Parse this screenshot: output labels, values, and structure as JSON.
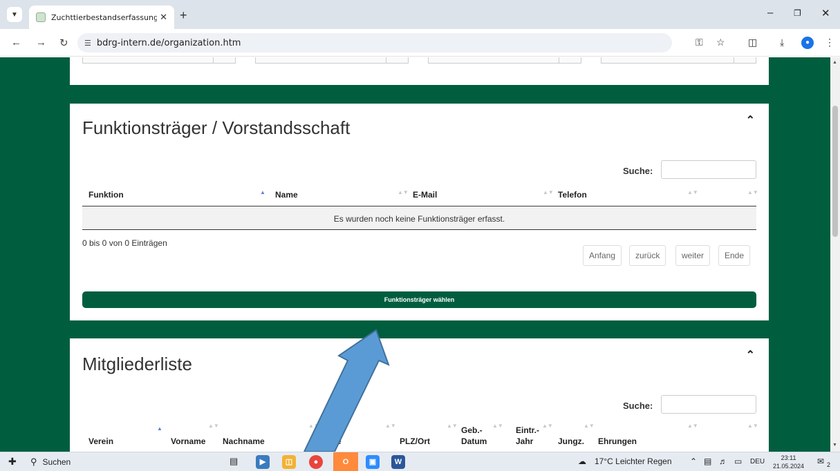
{
  "browser": {
    "tab_title": "Zuchttierbestandserfassung des",
    "url": "bdrg-intern.de/organization.htm",
    "new_tab": "+",
    "close_tab": "✕"
  },
  "section_functionaries": {
    "title": "Funktionsträger / Vorstandsschaft",
    "search_label": "Suche:",
    "search_value": "",
    "columns": [
      "Funktion",
      "Name",
      "E-Mail",
      "Telefon"
    ],
    "sorted_column": "Funktion",
    "empty_message": "Es wurden noch keine Funktionsträger erfasst.",
    "info": "0 bis 0 von 0 Einträgen",
    "pagination": [
      "Anfang",
      "zurück",
      "weiter",
      "Ende"
    ],
    "action_button": "Funktionsträger wählen"
  },
  "section_members": {
    "title": "Mitgliederliste",
    "search_label": "Suche:",
    "search_value": "",
    "columns": {
      "verein": "Verein",
      "vorname": "Vorname",
      "nachname": "Nachname",
      "strasse": "aße",
      "plz": "PLZ/Ort",
      "geb1": "Geb.-",
      "geb2": "Datum",
      "eintr1": "Eintr.-",
      "eintr2": "Jahr",
      "jungz": "Jungz.",
      "ehrungen": "Ehrungen"
    }
  },
  "taskbar": {
    "search_placeholder": "Suchen",
    "weather": "17°C  Leichter Regen",
    "lang": "DEU",
    "time": "23:11",
    "date": "21.05.2024",
    "notifications": "2"
  },
  "colors": {
    "brand_green": "#005e3f",
    "annotation_arrow": "#5b9bd5"
  }
}
